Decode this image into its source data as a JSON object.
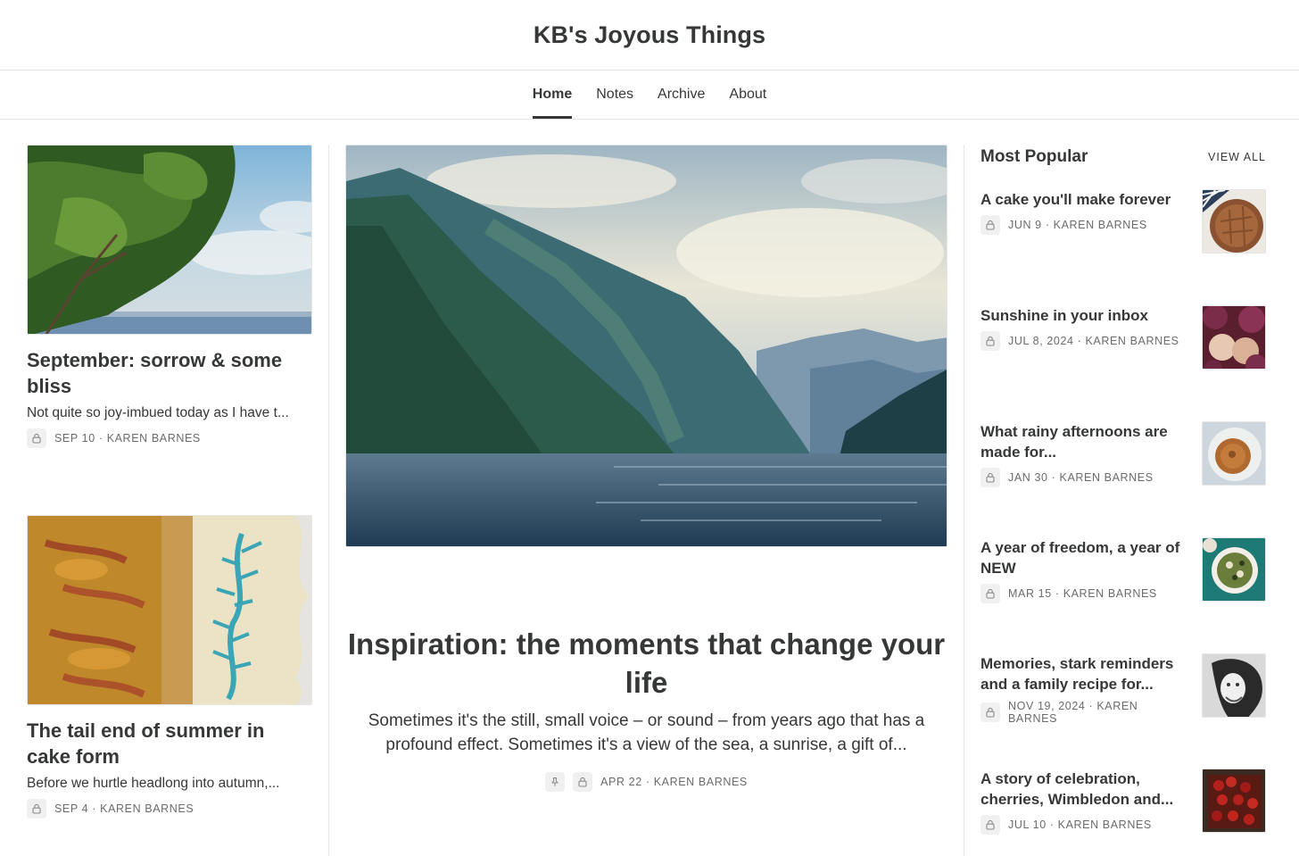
{
  "site": {
    "title": "KB's Joyous Things"
  },
  "nav": {
    "items": [
      {
        "label": "Home"
      },
      {
        "label": "Notes"
      },
      {
        "label": "Archive"
      },
      {
        "label": "About"
      }
    ],
    "active_item": "Home"
  },
  "left_posts": [
    {
      "title": "September: sorrow & some bliss",
      "subtitle": "Not quite so joy-imbued today as I have t...",
      "date": "SEP 10",
      "author": "KAREN BARNES",
      "locked": true
    },
    {
      "title": "The tail end of summer in cake form",
      "subtitle": "Before we hurtle headlong into autumn,...",
      "date": "SEP 4",
      "author": "KAREN BARNES",
      "locked": true
    }
  ],
  "featured": {
    "title": "Inspiration: the moments that change your life",
    "subtitle": "Sometimes it's the still, small voice – or sound – from years ago that has a profound effect. Sometimes it's a view of the sea, a sunrise, a gift of...",
    "date": "APR 22",
    "author": "KAREN BARNES",
    "pinned": true,
    "locked": true
  },
  "most_popular": {
    "title": "Most Popular",
    "view_all_label": "VIEW ALL",
    "items": [
      {
        "title": "A cake you'll make forever",
        "date": "JUN 9",
        "author": "KAREN BARNES",
        "locked": true
      },
      {
        "title": "Sunshine in your inbox",
        "date": "JUL 8, 2024",
        "author": "KAREN BARNES",
        "locked": true
      },
      {
        "title": "What rainy afternoons are made for...",
        "date": "JAN 30",
        "author": "KAREN BARNES",
        "locked": true
      },
      {
        "title": "A year of freedom, a year of NEW",
        "date": "MAR 15",
        "author": "KAREN BARNES",
        "locked": true
      },
      {
        "title": "Memories, stark reminders and a family recipe for...",
        "date": "NOV 19, 2024",
        "author": "KAREN BARNES",
        "locked": true
      },
      {
        "title": "A story of celebration, cherries, Wimbledon and...",
        "date": "JUL 10",
        "author": "KAREN BARNES",
        "locked": true
      }
    ]
  },
  "meta_separator": "·",
  "colors": {
    "text": "#363737",
    "muted": "#6b6b6b",
    "border": "#e6e6e6",
    "lock_bg": "#f0f0f0"
  },
  "icons": {
    "lock": "lock-icon",
    "pin": "pin-icon"
  }
}
